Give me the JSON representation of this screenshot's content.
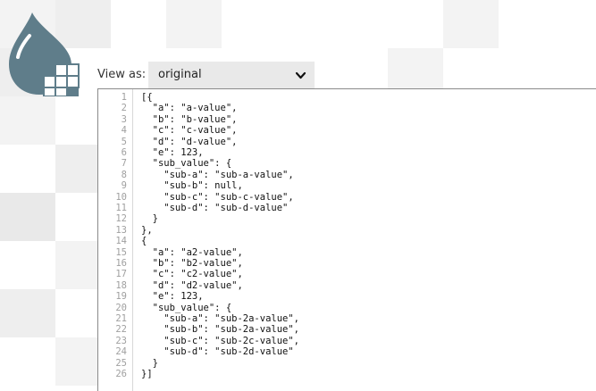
{
  "toolbar": {
    "view_as_label": "View as:",
    "view_mode": "original",
    "chevron_icon": "chevron-down-icon"
  },
  "logo": {
    "icon": "water-drop-logo",
    "color": "#5f7d8a"
  },
  "editor": {
    "lines": [
      "[{",
      "  \"a\": \"a-value\",",
      "  \"b\": \"b-value\",",
      "  \"c\": \"c-value\",",
      "  \"d\": \"d-value\",",
      "  \"e\": 123,",
      "  \"sub_value\": {",
      "    \"sub-a\": \"sub-a-value\",",
      "    \"sub-b\": null,",
      "    \"sub-c\": \"sub-c-value\",",
      "    \"sub-d\": \"sub-d-value\"",
      "  }",
      "},",
      "{",
      "  \"a\": \"a2-value\",",
      "  \"b\": \"b2-value\",",
      "  \"c\": \"c2-value\",",
      "  \"d\": \"d2-value\",",
      "  \"e\": 123,",
      "  \"sub_value\": {",
      "    \"sub-a\": \"sub-2a-value\",",
      "    \"sub-b\": \"sub-2a-value\",",
      "    \"sub-c\": \"sub-2c-value\",",
      "    \"sub-d\": \"sub-2d-value\"",
      "  }",
      "}]"
    ]
  }
}
